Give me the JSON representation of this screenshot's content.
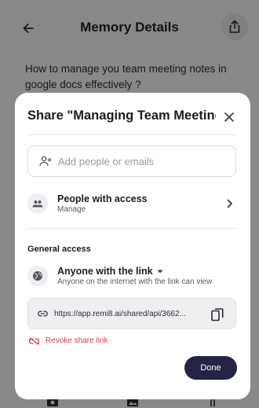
{
  "header": {
    "title": "Memory Details"
  },
  "memory": {
    "text": "How to manage you team meeting notes in google docs effectively ?"
  },
  "modal": {
    "title": "Share \"Managing Team Meeting...",
    "add_people": {
      "placeholder": "Add people or emails"
    },
    "people_with_access": {
      "title": "People with access",
      "subtitle": "Manage"
    },
    "general_access": {
      "label": "General access",
      "option_title": "Anyone with the link",
      "option_subtitle": "Anyone on the internet with the link can view"
    },
    "link": {
      "url": "https://app.remi8.ai/shared/api/3662..."
    },
    "revoke_label": "Revoke share link",
    "done_label": "Done"
  },
  "colors": {
    "accent": "#242446",
    "danger": "#d93a3a"
  },
  "icons": [
    "back-arrow-icon",
    "share-icon",
    "close-icon",
    "add-person-icon",
    "people-icon",
    "chevron-right-icon",
    "globe-icon",
    "dropdown-caret-icon",
    "link-icon",
    "copy-icon",
    "link-off-icon",
    "camera-icon",
    "image-icon",
    "attachment-icon"
  ]
}
